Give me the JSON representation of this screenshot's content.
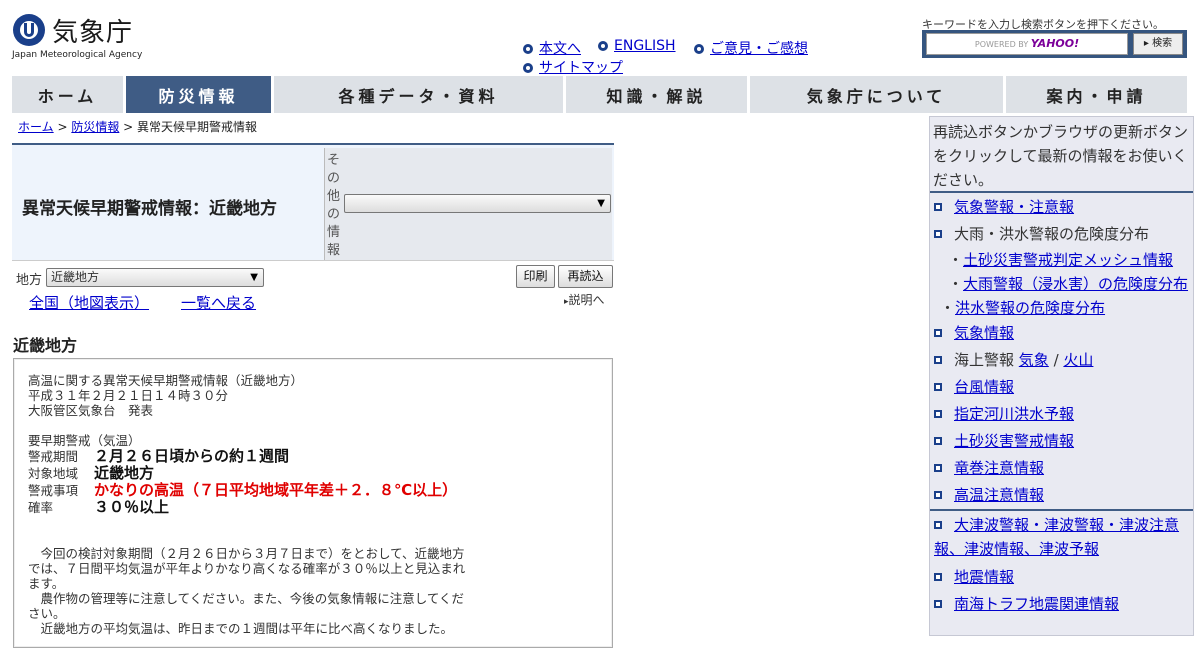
{
  "header": {
    "logo_jp": "気象庁",
    "logo_en": "Japan Meteorological Agency",
    "links": [
      "本文へ",
      "ENGLISH",
      "ご意見・ご感想",
      "サイトマップ"
    ],
    "search_hint": "キーワードを入力し検索ボタンを押下ください。",
    "search_powered": "POWERED BY",
    "search_brand": "YAHOO!",
    "search_button": "検索"
  },
  "nav": {
    "items": [
      "ホーム",
      "防災情報",
      "各種データ・資料",
      "知識・解説",
      "気象庁について",
      "案内・申請"
    ],
    "active_index": 1
  },
  "breadcrumb": {
    "home": "ホーム",
    "sep": " > ",
    "bosai": "防災情報",
    "current": "異常天候早期警戒情報"
  },
  "title": "異常天候早期警戒情報：近畿地方",
  "other_info_label": "その他の情報",
  "controls": {
    "area_label": "地方",
    "area_value": "近畿地方",
    "print": "印刷",
    "reload": "再読込",
    "link_map": "全国（地図表示）",
    "link_list": "一覧へ戻る",
    "explain": "説明へ"
  },
  "region_heading": "近畿地方",
  "report": {
    "header_lines": [
      "高温に関する異常天候早期警戒情報（近畿地方）",
      "平成３１年２月２１日１４時３０分",
      "大阪管区気象台　発表"
    ],
    "section": "要早期警戒（気温）",
    "rows": [
      {
        "k": "警戒期間",
        "v": "２月２６日頃からの約１週間"
      },
      {
        "k": "対象地域",
        "v": "近畿地方"
      },
      {
        "k": "警戒事項",
        "v": "かなりの高温（７日平均地域平年差＋２．８℃以上）"
      },
      {
        "k": "確率",
        "v": "３０％以上"
      }
    ],
    "para1": "　今回の検討対象期間（２月２６日から３月７日まで）をとおして、近畿地方では、７日間平均気温が平年よりかなり高くなる確率が３０％以上と見込まれます。",
    "para2": "　農作物の管理等に注意してください。また、今後の気象情報に注意してください。",
    "para3": "　近畿地方の平均気温は、昨日までの１週間は平年に比べ高くなりました。"
  },
  "sidebar": {
    "notice": "再読込ボタンかブラウザの更新ボタンをクリックして最新の情報をお使いください。",
    "warning": "気象警報・注意報",
    "risk_title": "大雨・洪水警報の危険度分布",
    "risk_sub": [
      "土砂災害警戒判定メッシュ情報",
      "大雨警報（浸水害）の危険度分布",
      "洪水警報の危険度分布"
    ],
    "weather_info": "気象情報",
    "marine_label": "海上警報",
    "marine_link1": "気象",
    "marine_sep": " / ",
    "marine_link2": "火山",
    "items": [
      "台風情報",
      "指定河川洪水予報",
      "土砂災害警戒情報",
      "竜巻注意情報",
      "高温注意情報"
    ],
    "items2": [
      "大津波警報・津波警報・津波注意報、津波情報、津波予報",
      "地震情報",
      "南海トラフ地震関連情報"
    ]
  }
}
